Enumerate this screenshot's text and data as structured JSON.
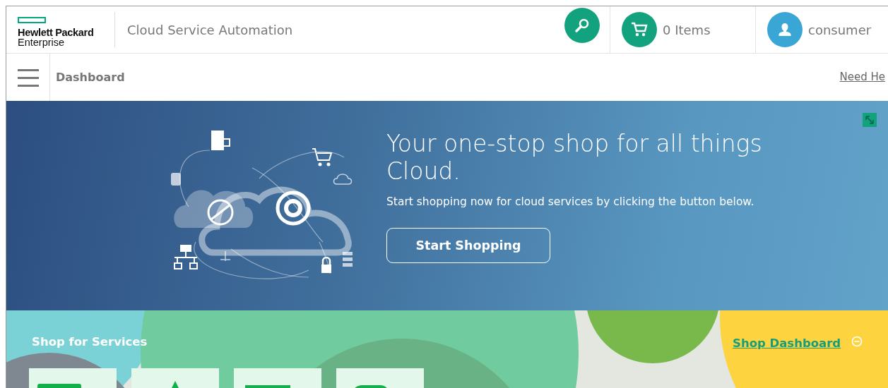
{
  "header": {
    "logo": {
      "line1": "Hewlett Packard",
      "line2": "Enterprise"
    },
    "app_title": "Cloud Service Automation",
    "cart": {
      "label": "0 Items"
    },
    "user": {
      "name": "consumer"
    }
  },
  "subheader": {
    "title": "Dashboard",
    "help_link": "Need He"
  },
  "banner": {
    "heading": "Your one-stop shop for all things Cloud.",
    "subtext": "Start shopping now for cloud services by clicking the button below.",
    "button": "Start Shopping"
  },
  "shop": {
    "title": "Shop for Services",
    "dashboard_link": "Shop Dashboard"
  }
}
